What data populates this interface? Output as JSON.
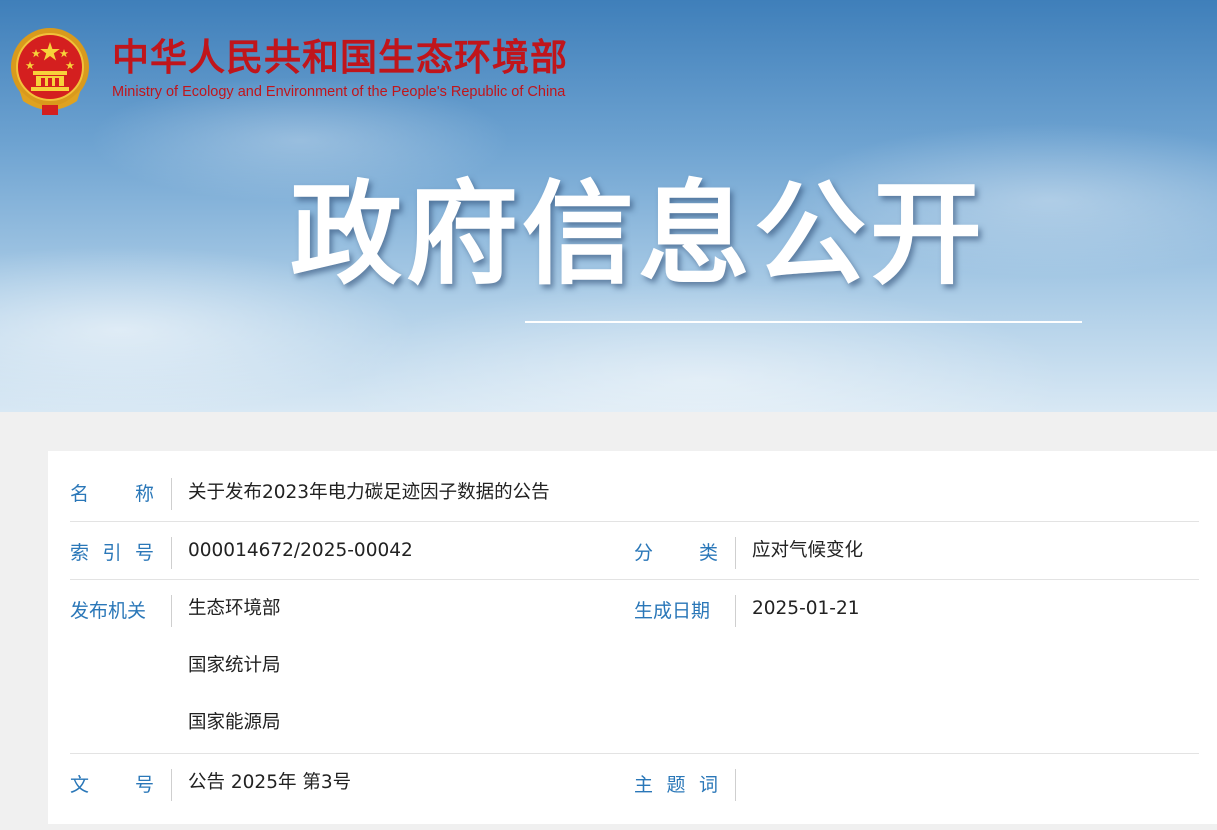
{
  "header": {
    "ministry_name_cn": "中华人民共和国生态环境部",
    "ministry_name_en": "Ministry of Ecology and Environment of the People's Republic of China",
    "banner_title": "政府信息公开",
    "brand_red": "#c0151b",
    "emblem_icon": "national-emblem-icon"
  },
  "info_table": {
    "label_color": "#2a77b8",
    "name": {
      "label_chars": [
        "名",
        "称"
      ],
      "value": "关于发布2023年电力碳足迹因子数据的公告"
    },
    "index_no": {
      "label_chars": [
        "索",
        "引",
        "号"
      ],
      "value": "000014672/2025-00042"
    },
    "category": {
      "label_chars": [
        "分",
        "类"
      ],
      "value": "应对气候变化"
    },
    "publisher": {
      "label": "发布机关",
      "values": [
        "生态环境部",
        "国家统计局",
        "国家能源局"
      ]
    },
    "created_date": {
      "label": "生成日期",
      "value": "2025-01-21"
    },
    "doc_no": {
      "label_chars": [
        "文",
        "号"
      ],
      "value": "公告 2025年 第3号"
    },
    "keywords": {
      "label_chars": [
        "主",
        "题",
        "词"
      ],
      "value": ""
    }
  }
}
